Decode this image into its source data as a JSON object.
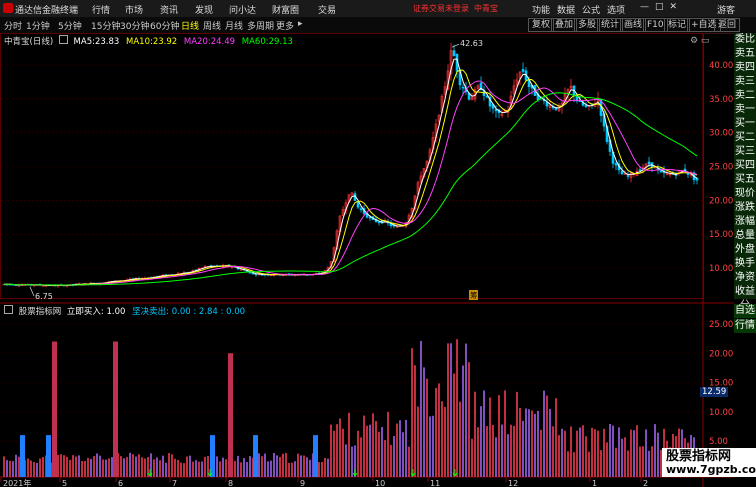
{
  "app": {
    "title": "通达信金融终端"
  },
  "top_menu": [
    "行情",
    "市场",
    "资讯",
    "发现",
    "问小达",
    "财富圈",
    "交易"
  ],
  "status": {
    "security": "证券交易未登录",
    "stock": "中青宝"
  },
  "right_menu": [
    "功能",
    "数据",
    "公式",
    "选项"
  ],
  "window_controls": [
    "—",
    "□",
    "✕"
  ],
  "guest": "游客",
  "toolbar": {
    "periods": [
      "分时",
      "1分钟",
      "5分钟",
      "15分钟",
      "30分钟",
      "60分钟",
      "日线",
      "周线",
      "月线",
      "多周期",
      "更多"
    ],
    "active": "日线",
    "right_buttons": [
      "复权",
      "叠加",
      "多股",
      "统计",
      "画线",
      "F10",
      "标记",
      "+自选",
      "返回"
    ]
  },
  "main_legend": {
    "name": "中青宝(日线)",
    "ma": [
      {
        "label": "MA5:",
        "value": "23.83",
        "color": "#ffffff"
      },
      {
        "label": "MA10:",
        "value": "23.92",
        "color": "#ffff00"
      },
      {
        "label": "MA20:",
        "value": "24.49",
        "color": "#ff40ff"
      },
      {
        "label": "MA60:",
        "value": "29.13",
        "color": "#00ff00"
      }
    ]
  },
  "sub_legend": {
    "name": "股票指标网",
    "buy_label": "立即买入:",
    "buy_value": "1.00",
    "sell_label": "坚决卖出:",
    "sell_values": "0.00 : 2.84 : 0.00"
  },
  "annotations": {
    "high": "42.63",
    "low": "6.75",
    "marker": "筹"
  },
  "side_panel": [
    "委比",
    "卖五",
    "卖四",
    "卖三",
    "卖二",
    "卖一",
    "买一",
    "买二",
    "买三",
    "买四",
    "买五",
    "现价",
    "涨跌",
    "涨幅",
    "总量",
    "外盘",
    "换手",
    "净资",
    "收益",
    "分",
    "自选",
    "行情"
  ],
  "price_axis": [
    "40.00",
    "35.00",
    "30.00",
    "25.00",
    "20.00",
    "15.00",
    "10.00"
  ],
  "indicator_axis": [
    "25.00",
    "20.00",
    "15.00",
    "10.00",
    "5.00"
  ],
  "current_value_badge": "12.59",
  "x_axis_labels": [
    "2021年",
    "5",
    "6",
    "7",
    "8",
    "9",
    "10",
    "11",
    "12",
    "1",
    "2"
  ],
  "watermark": {
    "name": "股票指标网",
    "url": "www.7gpzb.com"
  },
  "colors": {
    "up": "#ff3232",
    "down": "#00c8ff",
    "ma5": "#ffffff",
    "ma10": "#ffff00",
    "ma20": "#ff40ff",
    "ma60": "#00ff00",
    "grid": "#5a0000"
  }
}
